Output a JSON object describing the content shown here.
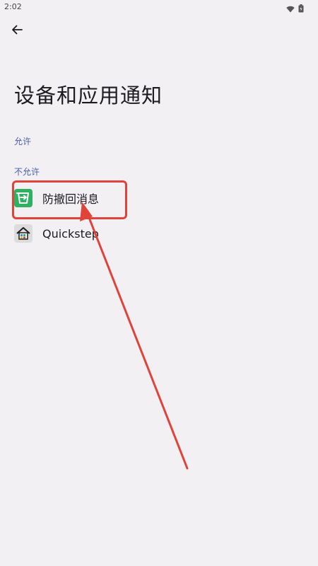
{
  "status_bar": {
    "time": "2:02",
    "icons": [
      "wifi-icon",
      "battery-icon"
    ]
  },
  "toolbar": {
    "back_icon": "back-arrow-icon"
  },
  "title": "设备和应用通知",
  "sections": {
    "allowed": {
      "label": "允许"
    },
    "denied": {
      "label": "不允许",
      "apps": [
        {
          "name": "防撤回消息",
          "icon": "anti-recall-app-icon",
          "icon_color": "#2fb163"
        },
        {
          "name": "Quickstep",
          "icon": "quickstep-home-icon",
          "icon_color": "#dcdcdc"
        }
      ]
    }
  },
  "annotation": {
    "highlight_color": "#e0433a",
    "arrow_color": "#e0433a"
  }
}
